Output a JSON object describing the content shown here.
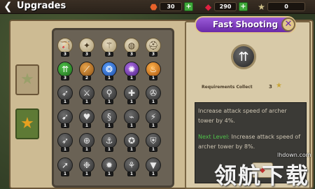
{
  "header": {
    "back_glyph": "❮",
    "title": "Upgrades"
  },
  "resources": {
    "coins": "30",
    "gems": "290",
    "stars": "0",
    "plus_label": "+"
  },
  "detail": {
    "name": "Fast Shooting",
    "close_glyph": "✕",
    "icon_glyph": "⇈",
    "requirements_label": "Requirements Collect",
    "requirements_value": "3",
    "description": "Increase attack speed of archer tower by 4%.",
    "next_level_label": "Next Level:",
    "next_level_text": "Increase attack speed of archer tower by 8%.",
    "upgrade_icon": "◆"
  },
  "tabs": [
    {
      "name": "star-tab-silver",
      "glyph": "★",
      "color": "#9aa06a"
    },
    {
      "name": "star-tab-gold",
      "glyph": "★",
      "color": "#e8a020"
    }
  ],
  "grid": {
    "rows": [
      [
        {
          "g": "🏹",
          "lvl": "3",
          "s": "done"
        },
        {
          "g": "✦",
          "lvl": "3",
          "s": "done"
        },
        {
          "g": "⚚",
          "lvl": "3",
          "s": "done"
        },
        {
          "g": "◍",
          "lvl": "3",
          "s": "done"
        },
        {
          "g": "⛑",
          "lvl": "3",
          "s": "done"
        }
      ],
      [
        {
          "g": "⇈",
          "lvl": "3",
          "s": "owned g"
        },
        {
          "g": "⟋",
          "lvl": "2",
          "s": "owned o"
        },
        {
          "g": "❂",
          "lvl": "1",
          "s": "owned b"
        },
        {
          "g": "✺",
          "lvl": "1",
          "s": "owned p"
        },
        {
          "g": "♨",
          "lvl": "1",
          "s": "owned y"
        }
      ],
      [
        {
          "g": "➶",
          "lvl": "1",
          "s": ""
        },
        {
          "g": "⚔",
          "lvl": "1",
          "s": ""
        },
        {
          "g": "⚲",
          "lvl": "1",
          "s": ""
        },
        {
          "g": "✚",
          "lvl": "1",
          "s": ""
        },
        {
          "g": "✇",
          "lvl": "1",
          "s": ""
        }
      ],
      [
        {
          "g": "➹",
          "lvl": "1",
          "s": ""
        },
        {
          "g": "♥",
          "lvl": "1",
          "s": ""
        },
        {
          "g": "§",
          "lvl": "1",
          "s": ""
        },
        {
          "g": "⌁",
          "lvl": "1",
          "s": ""
        },
        {
          "g": "⚡",
          "lvl": "1",
          "s": ""
        }
      ],
      [
        {
          "g": "➶",
          "lvl": "1",
          "s": ""
        },
        {
          "g": "⊕",
          "lvl": "1",
          "s": ""
        },
        {
          "g": "⚓",
          "lvl": "1",
          "s": ""
        },
        {
          "g": "✪",
          "lvl": "1",
          "s": ""
        },
        {
          "g": "⛨",
          "lvl": "1",
          "s": ""
        }
      ],
      [
        {
          "g": "➚",
          "lvl": "1",
          "s": ""
        },
        {
          "g": "❉",
          "lvl": "1",
          "s": ""
        },
        {
          "g": "✹",
          "lvl": "1",
          "s": ""
        },
        {
          "g": "⚘",
          "lvl": "1",
          "s": ""
        },
        {
          "g": "▼",
          "lvl": "1",
          "s": ""
        }
      ]
    ]
  },
  "watermark": {
    "url": "lhdown.com",
    "text": "领航下载"
  }
}
